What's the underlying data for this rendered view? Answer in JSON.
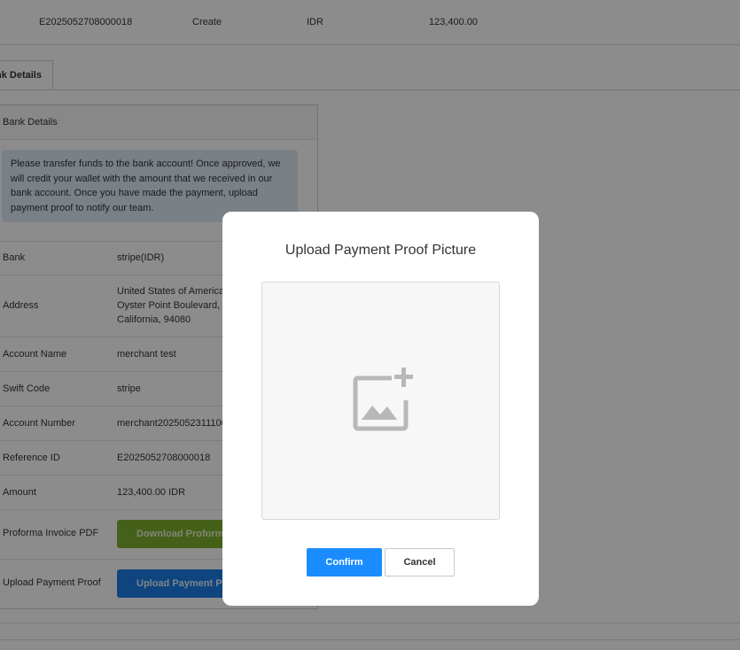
{
  "top_row": {
    "reference": "E2025052708000018",
    "status": "Create",
    "currency": "IDR",
    "amount": "123,400.00"
  },
  "tab": {
    "label": "nk Details"
  },
  "panel": {
    "title": "Bank Details",
    "notice": "Please transfer funds to the bank account! Once approved, we will credit your wallet with the amount that we received in our bank account. Once you have made the payment, upload payment proof to notify our team.",
    "rows": [
      {
        "label": "Bank",
        "value": "stripe(IDR)"
      },
      {
        "label": "Address",
        "value_lines": [
          "United States of America,",
          "Oyster Point Boulevard, S",
          "California, 94080"
        ]
      },
      {
        "label": "Account Name",
        "value": "merchant test"
      },
      {
        "label": "Swift Code",
        "value": "stripe"
      },
      {
        "label": "Account Number",
        "value": "merchant2025052311100"
      },
      {
        "label": "Reference ID",
        "value": "E2025052708000018"
      },
      {
        "label": "Amount",
        "value": "123,400.00 IDR"
      },
      {
        "label": "Proforma Invoice PDF",
        "button": "Download Proforma"
      },
      {
        "label": "Upload Payment Proof",
        "button": "Upload Payment Pr"
      }
    ]
  },
  "modal": {
    "title": "Upload Payment Proof Picture",
    "dropzone_icon": "add-image-icon",
    "confirm_label": "Confirm",
    "cancel_label": "Cancel"
  },
  "colors": {
    "confirm": "#1a8cff",
    "download": "#7fb02c",
    "upload": "#1d7fe8",
    "notice_bg": "#dde9f5"
  }
}
